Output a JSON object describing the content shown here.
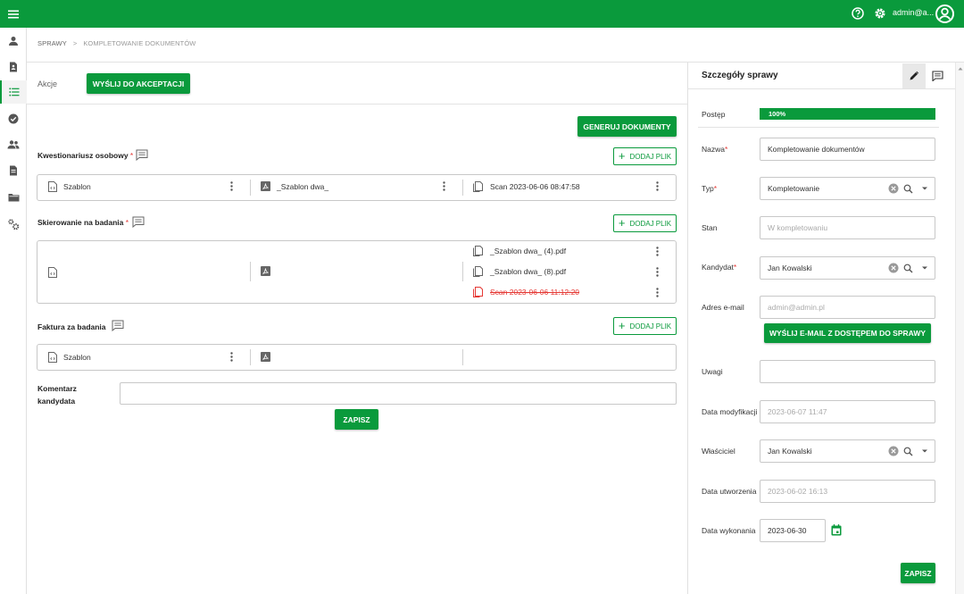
{
  "topbar": {
    "user_label": "admin@a...",
    "icons": [
      "menu-icon",
      "help-icon",
      "settings-icon",
      "account-circle-icon"
    ],
    "accent_color": "#0a9a3c"
  },
  "sidebar": {
    "icons": [
      "person-icon",
      "contact-document-icon",
      "list-icon",
      "check-circle-icon",
      "group-icon",
      "document-icon",
      "folder-icon",
      "settings-cogs-icon"
    ],
    "active_index": 2
  },
  "breadcrumb": {
    "root": "SPRAWY",
    "separator": ">",
    "current": "KOMPLETOWANIE DOKUMENTÓW"
  },
  "actions": {
    "label": "Akcje",
    "send_button": "WYŚLIJ DO AKCEPTACJI"
  },
  "generate_button": "GENERUJ DOKUMENTY",
  "sections": [
    {
      "label": "Kwestionariusz osobowy",
      "required_mark": "*",
      "add_button": "DODAJ PLIK",
      "col1": "Szablon",
      "col2": "_Szablon dwa_",
      "col3": [
        "Scan 2023-06-06 08:47:58"
      ]
    },
    {
      "label": "Skierowanie na badania",
      "required_mark": "*",
      "add_button": "DODAJ PLIK",
      "col1": "",
      "col2": "",
      "col3": [
        "_Szablon dwa_ (4).pdf",
        "_Szablon dwa_ (8).pdf",
        "Scan 2023-06-06 11:12:20"
      ]
    },
    {
      "label": "Faktura za badania",
      "required_mark": "",
      "add_button": "DODAJ PLIK",
      "col1": "Szablon",
      "col2": "",
      "col3": []
    }
  ],
  "comment": {
    "label_line1": "Komentarz",
    "label_line2": "kandydata",
    "value": "",
    "save_button": "ZAPISZ"
  },
  "details": {
    "title": "Szczegóły sprawy",
    "progress_label": "Postęp",
    "progress_text": "100%",
    "progress_value": 100,
    "name_label": "Nazwa",
    "name_value": "Kompletowanie dokumentów",
    "type_label": "Typ",
    "type_value": "Kompletowanie",
    "state_label": "Stan",
    "state_placeholder": "W kompletowaniu",
    "candidate_label": "Kandydat",
    "candidate_value": "Jan Kowalski",
    "email_label": "Adres e-mail",
    "email_placeholder": "admin@admin.pl",
    "email_button": "WYŚLIJ E-MAIL Z DOSTĘPEM DO SPRAWY",
    "notes_label": "Uwagi",
    "notes_value": "",
    "modified_label": "Data modyfikacji",
    "modified_value": "2023-06-07 11:47",
    "owner_label": "Właściciel",
    "owner_value": "Jan Kowalski",
    "created_label": "Data utworzenia",
    "created_value": "2023-06-02 16:13",
    "due_label": "Data wykonania",
    "due_value": "2023-06-30",
    "save_button": "ZAPISZ",
    "required_mark": "*"
  }
}
